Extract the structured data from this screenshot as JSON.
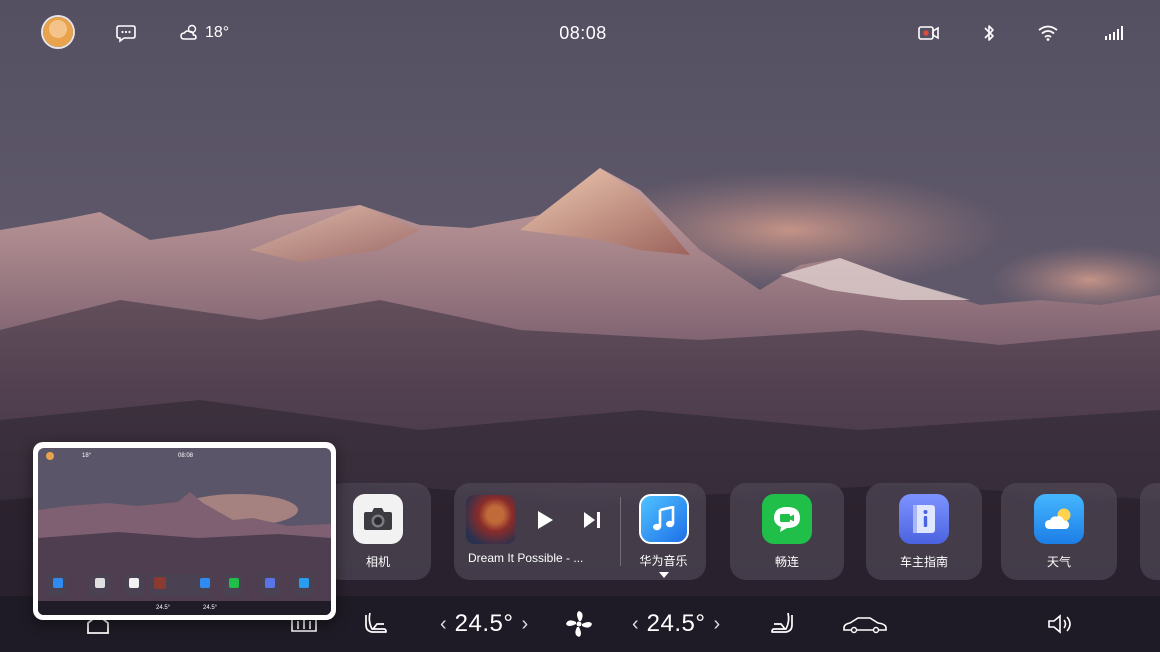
{
  "status_bar": {
    "weather_temp": "18°",
    "clock": "08:08"
  },
  "dock": {
    "camera_label": "相机",
    "music": {
      "title": "Dream It Possible - ...",
      "app_label": "华为音乐"
    },
    "changlian_label": "畅连",
    "guide_label": "车主指南",
    "weather_label": "天气"
  },
  "climate": {
    "left_temp": "24.5°",
    "right_temp": "24.5°"
  },
  "preview": {
    "clock": "08:08",
    "temp": "18°",
    "left_temp": "24.5°",
    "right_temp": "24.5°"
  },
  "colors": {
    "camera_bg": "#f2f2f2",
    "music_app": "#2f8bf0",
    "changlian": "#1fbf4a",
    "guide": "#5a74e8",
    "weather": "#2a9cf0"
  }
}
